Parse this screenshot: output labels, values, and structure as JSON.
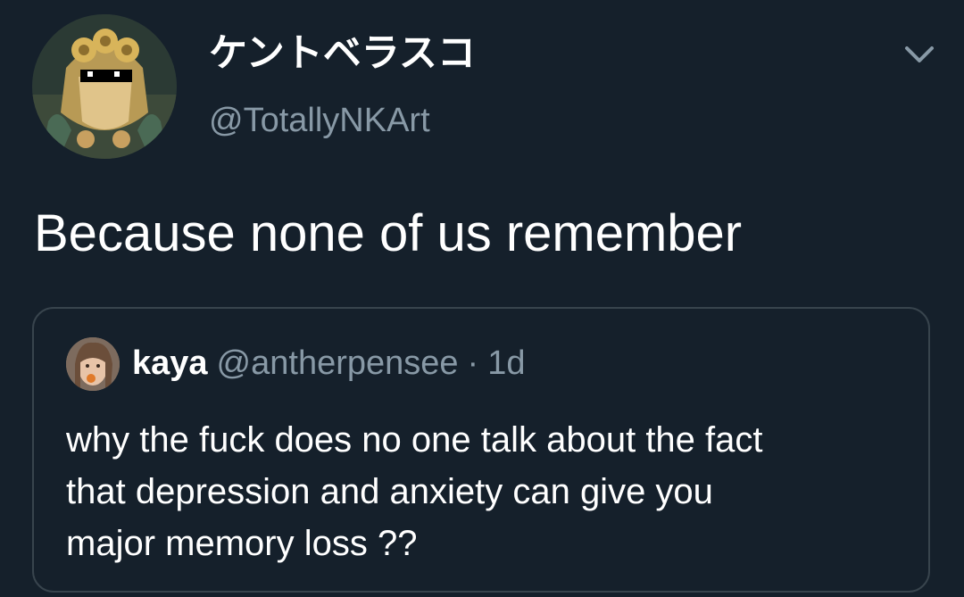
{
  "author": {
    "display_name": "ケントベラスコ",
    "handle": "@TotallyNKArt"
  },
  "tweet": {
    "text": "Because none of us remember"
  },
  "quoted_tweet": {
    "name": "kaya",
    "handle": "@antherpensee",
    "separator": "·",
    "time": "1d",
    "lines": [
      "why the fuck does no one talk about the fact",
      "that depression and anxiety can give you",
      "major memory loss ??"
    ]
  },
  "icons": {
    "menu": "chevron-down-icon"
  },
  "colors": {
    "background": "#15202b",
    "primary_text": "#ffffff",
    "secondary_text": "#8899a6",
    "border": "#38444d"
  }
}
